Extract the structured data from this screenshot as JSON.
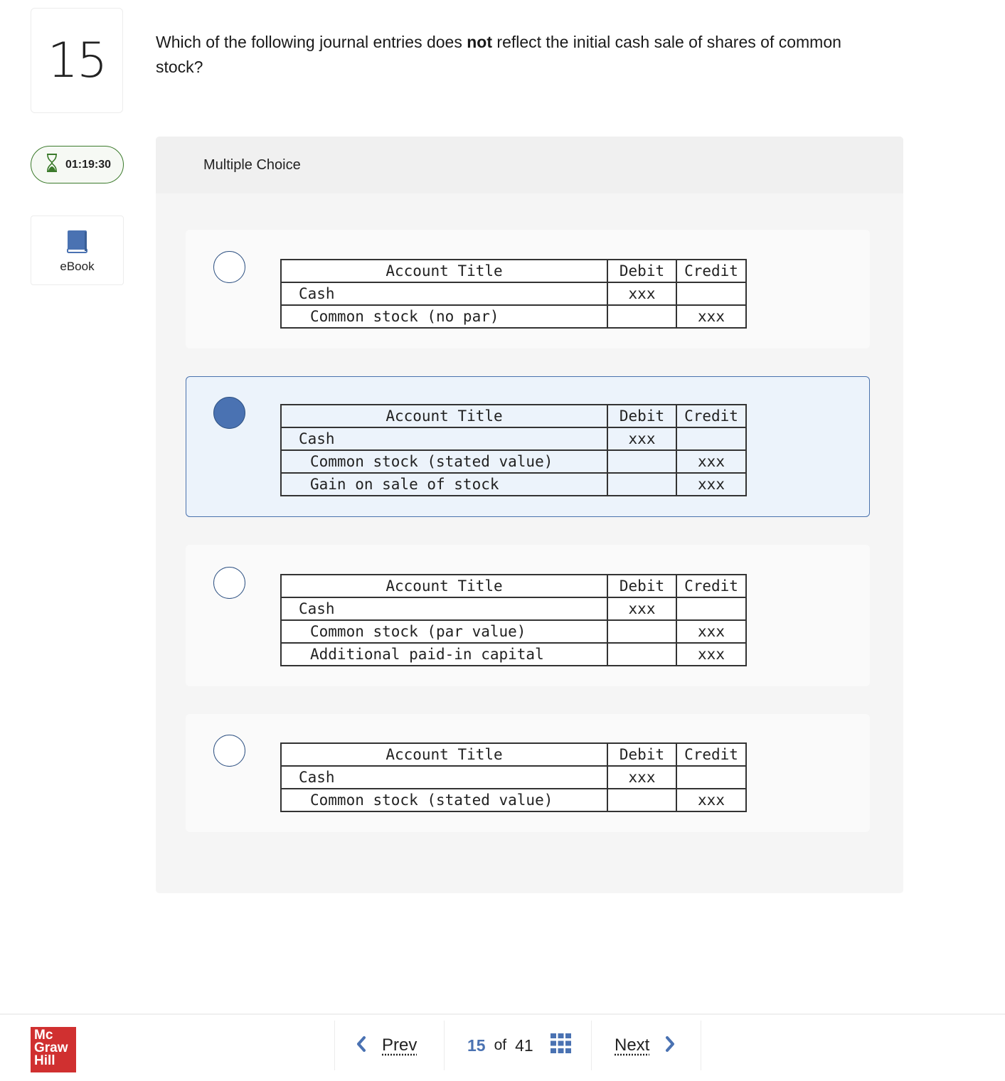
{
  "question": {
    "number": "15",
    "text_before": "Which of the following journal entries does ",
    "text_bold": "not",
    "text_after": " reflect the initial cash sale of shares of common stock?"
  },
  "timer": {
    "icon": "hourglass-icon",
    "value": "01:19:30"
  },
  "ebook": {
    "icon": "book-icon",
    "label": "eBook"
  },
  "panel": {
    "title": "Multiple Choice"
  },
  "table_headers": {
    "title": "Account Title",
    "debit": "Debit",
    "credit": "Credit"
  },
  "choices": [
    {
      "selected": false,
      "rows": [
        {
          "account": "Cash",
          "indent": false,
          "debit": "xxx",
          "credit": ""
        },
        {
          "account": "Common stock (no par)",
          "indent": true,
          "debit": "",
          "credit": "xxx"
        }
      ]
    },
    {
      "selected": true,
      "rows": [
        {
          "account": "Cash",
          "indent": false,
          "debit": "xxx",
          "credit": ""
        },
        {
          "account": "Common stock (stated value)",
          "indent": true,
          "debit": "",
          "credit": "xxx"
        },
        {
          "account": "Gain on sale of stock",
          "indent": true,
          "debit": "",
          "credit": "xxx"
        }
      ]
    },
    {
      "selected": false,
      "rows": [
        {
          "account": "Cash",
          "indent": false,
          "debit": "xxx",
          "credit": ""
        },
        {
          "account": "Common stock (par value)",
          "indent": true,
          "debit": "",
          "credit": "xxx"
        },
        {
          "account": "Additional paid-in capital",
          "indent": true,
          "debit": "",
          "credit": "xxx"
        }
      ]
    },
    {
      "selected": false,
      "rows": [
        {
          "account": "Cash",
          "indent": false,
          "debit": "xxx",
          "credit": ""
        },
        {
          "account": "Common stock (stated value)",
          "indent": true,
          "debit": "",
          "credit": "xxx"
        }
      ]
    }
  ],
  "footer": {
    "logo_lines": [
      "Mc",
      "Graw",
      "Hill"
    ],
    "prev_label": "Prev",
    "next_label": "Next",
    "current": "15",
    "of_label": "of",
    "total": "41"
  },
  "colors": {
    "accent": "#4a72b2",
    "timer_green": "#3b7a2b",
    "logo_red": "#d03030",
    "selected_bg": "#ecf3fb"
  }
}
